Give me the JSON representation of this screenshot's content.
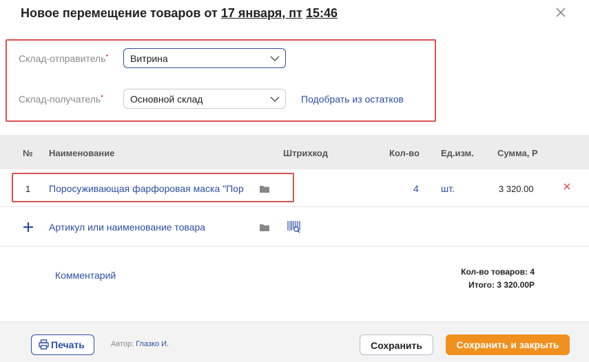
{
  "header": {
    "title_prefix": "Новое перемещение товаров от",
    "date": "17 января, пт",
    "time": "15:46"
  },
  "warehouses": {
    "sender_label": "Склад-отправитель",
    "sender_value": "Витрина",
    "receiver_label": "Склад-получатель",
    "receiver_value": "Основной склад",
    "required_mark": "•",
    "pick_link": "Подобрать из остатков"
  },
  "table": {
    "columns": [
      "№",
      "Наименование",
      "Штрихкод",
      "Кол-во",
      "Ед.изм.",
      "Сумма, Р"
    ],
    "rows": [
      {
        "num": "1",
        "name": "Поросуживающая фарфоровая маска \"Пор",
        "barcode": "",
        "qty": "4",
        "unit": "шт.",
        "sum": "3 320.00"
      }
    ]
  },
  "add_item": {
    "placeholder": "Артикул или наименование товара"
  },
  "comment_link": "Комментарий",
  "totals": {
    "count_label": "Кол-во товаров:",
    "count_value": "4",
    "total_label": "Итого:",
    "total_value": "3 320.00Р"
  },
  "footer": {
    "print_label": "Печать",
    "author_label": "Автор:",
    "author_name": "Глазко И.",
    "save_label": "Сохранить",
    "save_close_label": "Сохранить и закрыть"
  },
  "colors": {
    "accent_blue": "#2d4ea2",
    "accent_orange": "#f0901f",
    "highlight_red": "#d9534f",
    "required_red": "#e2474a"
  }
}
